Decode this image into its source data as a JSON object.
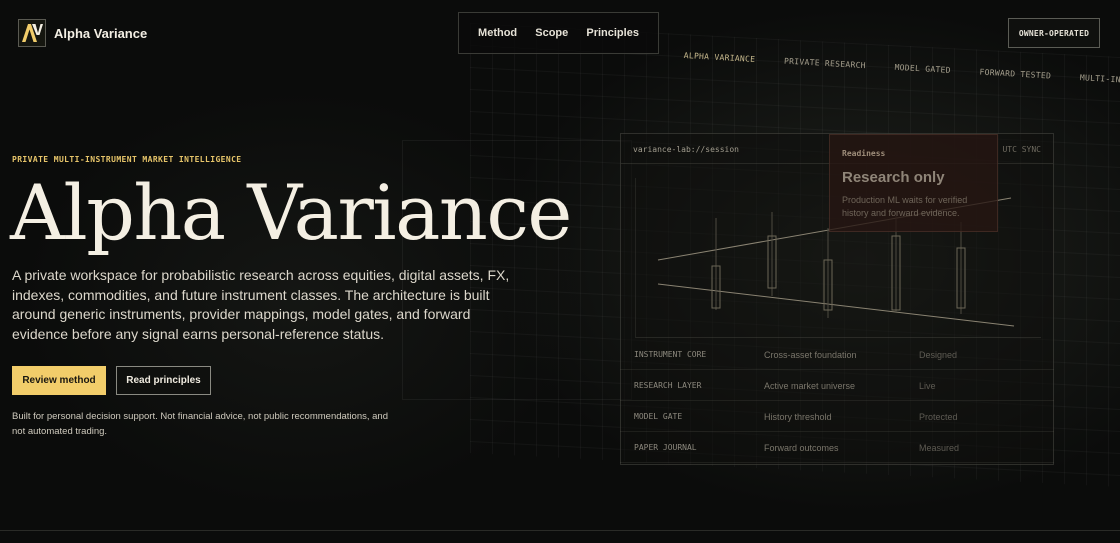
{
  "header": {
    "logo_text": "AV",
    "brand_name": "Alpha Variance",
    "nav": [
      {
        "label": "Method"
      },
      {
        "label": "Scope"
      },
      {
        "label": "Principles"
      }
    ],
    "owner_badge": "OWNER-OPERATED"
  },
  "ticker": [
    "ALPHA VARIANCE",
    "PRIVATE RESEARCH",
    "MODEL GATED",
    "FORWARD TESTED",
    "MULTI-INSTRUMENT"
  ],
  "hero": {
    "eyebrow": "PRIVATE MULTI-INSTRUMENT MARKET INTELLIGENCE",
    "title": "Alpha Variance",
    "description": "A private workspace for probabilistic research across equities, digital assets, FX, indexes, commodities, and future instrument classes. The architecture is built around generic instruments, provider mappings, model gates, and forward evidence before any signal earns personal-reference status.",
    "primary_cta": "Review method",
    "secondary_cta": "Read principles",
    "disclaimer": "Built for personal decision support. Not financial advice, not public recommendations, and not automated trading."
  },
  "session": {
    "label": "variance-lab://session",
    "utc": "UTC SYNC",
    "readiness": {
      "eyebrow": "Readiness",
      "title": "Research only",
      "body": "Production ML waits for verified history and forward evidence."
    },
    "rows": [
      {
        "key": "INSTRUMENT CORE",
        "desc": "Cross-asset foundation",
        "status": "Designed"
      },
      {
        "key": "RESEARCH LAYER",
        "desc": "Active market universe",
        "status": "Live"
      },
      {
        "key": "MODEL GATE",
        "desc": "History threshold",
        "status": "Protected"
      },
      {
        "key": "PAPER JOURNAL",
        "desc": "Forward outcomes",
        "status": "Measured"
      }
    ]
  },
  "colors": {
    "background": "#0b0c0b",
    "accent": "#f2cd6a",
    "eyebrow": "#e7c56a",
    "text": "#f4efe3"
  }
}
